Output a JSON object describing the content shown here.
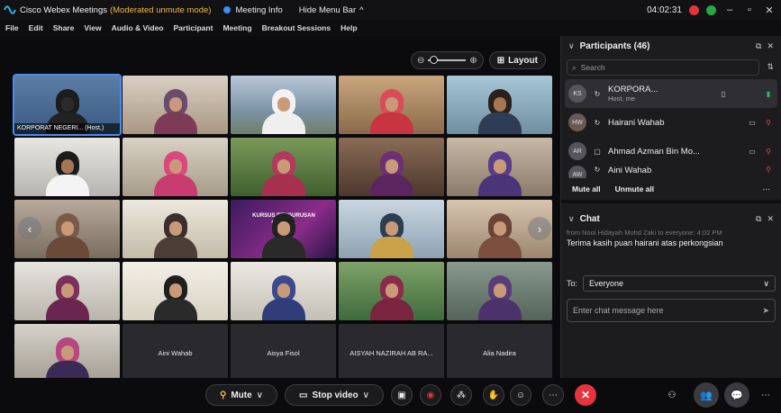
{
  "titlebar": {
    "app_title": "Cisco Webex Meetings",
    "mode": "(Moderated unmute mode)",
    "meeting_info": "Meeting Info",
    "hide_menu_bar": "Hide Menu Bar",
    "clock": "04:02:31"
  },
  "menubar": [
    "File",
    "Edit",
    "Share",
    "View",
    "Audio & Video",
    "Participant",
    "Meeting",
    "Breakout Sessions",
    "Help"
  ],
  "video_controls": {
    "layout_label": "Layout"
  },
  "tiles": [
    {
      "name": "KORPORAT NEGERI... (Host,)"
    },
    {
      "name": "Aini Wahab"
    },
    {
      "name": "Aisya Fisol"
    },
    {
      "name": "AISYAH NAZIRAH AB RA..."
    },
    {
      "name": "Alia Nadira"
    }
  ],
  "poster_text": "KURSUS PENGURUSAN ORGAN...",
  "participants": {
    "title": "Participants (46)",
    "search_placeholder": "Search",
    "rows": [
      {
        "initials": "KS",
        "name": "KORPORA...",
        "sub": "Host, me"
      },
      {
        "initials": "HW",
        "name": "Hairani Wahab",
        "sub": ""
      },
      {
        "initials": "AR",
        "name": "Ahmad Azman Bin Mo...",
        "sub": ""
      },
      {
        "initials": "AW",
        "name": "Aini Wahab",
        "sub": ""
      }
    ],
    "mute_all": "Mute all",
    "unmute_all": "Unmute all"
  },
  "chat": {
    "title": "Chat",
    "hidden_line": "from Nooi Hidayah Mohd Zaki to everyone:    4:02 PM",
    "message": "Terima kasih puan hairani atas perkongsian",
    "to_label": "To:",
    "to_value": "Everyone",
    "input_placeholder": "Enter chat message here"
  },
  "toolbar": {
    "mute_label": "Mute",
    "stop_video_label": "Stop video"
  },
  "colors": {
    "accent": "#4a8cf0",
    "end_call": "#e5343d",
    "moderated_mode": "#f1b64a",
    "mic_on": "#2fbf5a"
  }
}
